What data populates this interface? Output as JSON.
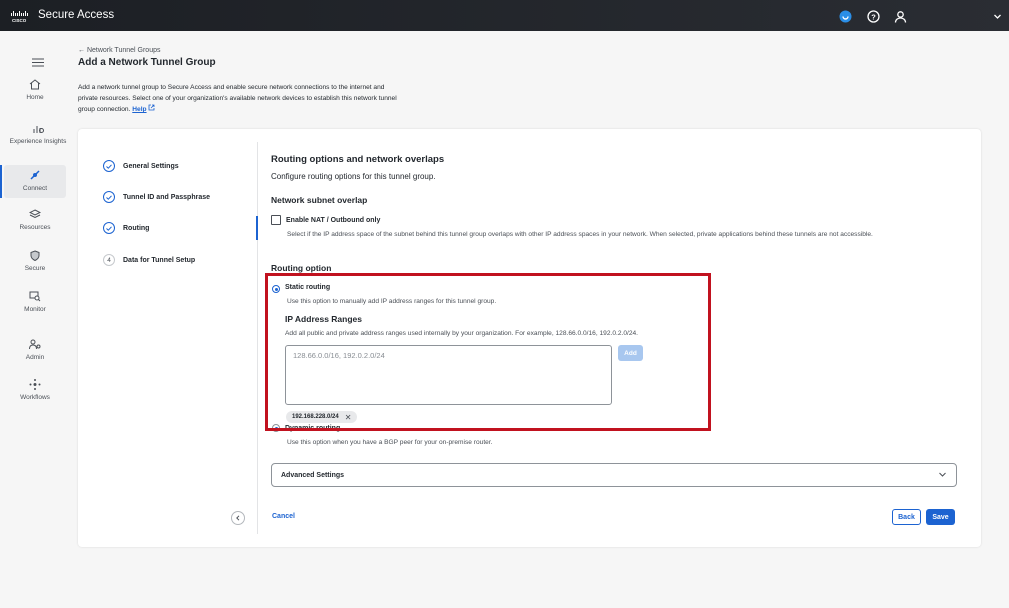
{
  "topbar": {
    "app_title": "Secure Access"
  },
  "sidebar": {
    "items": [
      {
        "label": "Home",
        "icon": "home-icon"
      },
      {
        "label": "Experience Insights",
        "icon": "insights-icon"
      },
      {
        "label": "Connect",
        "icon": "connect-icon"
      },
      {
        "label": "Resources",
        "icon": "resources-icon"
      },
      {
        "label": "Secure",
        "icon": "shield-icon"
      },
      {
        "label": "Monitor",
        "icon": "monitor-icon"
      },
      {
        "label": "Admin",
        "icon": "admin-icon"
      },
      {
        "label": "Workflows",
        "icon": "workflows-icon"
      }
    ],
    "active": "Connect"
  },
  "header": {
    "breadcrumb": "← Network Tunnel Groups",
    "title": "Add a Network Tunnel Group",
    "description": "Add a network tunnel group to Secure Access and enable secure network connections to the internet and private resources. Select one of your organization's available network devices to establish this network tunnel group connection.",
    "help_label": "Help"
  },
  "steps": [
    {
      "label": "General Settings",
      "status": "done"
    },
    {
      "label": "Tunnel ID and Passphrase",
      "status": "done"
    },
    {
      "label": "Routing",
      "status": "current"
    },
    {
      "label": "Data for Tunnel Setup",
      "status": "pending",
      "number": "4"
    }
  ],
  "routing": {
    "title": "Routing options and network overlaps",
    "subtitle": "Configure routing options for this tunnel group.",
    "overlap_heading": "Network subnet overlap",
    "nat_label": "Enable NAT / Outbound only",
    "nat_desc": "Select if the IP address space of the subnet behind this tunnel group overlaps with other IP address spaces in your network. When selected, private applications behind these tunnels are not accessible.",
    "option_heading": "Routing option",
    "static_label": "Static routing",
    "static_desc": "Use this option to manually add IP address ranges for this tunnel group.",
    "ranges_heading": "IP Address Ranges",
    "ranges_desc": "Add all public and private address ranges used internally by your organization. For example, 128.66.0.0/16, 192.0.2.0/24.",
    "textarea_placeholder": "128.66.0.0/16, 192.0.2.0/24",
    "add_label": "Add",
    "chip_value": "192.168.228.0/24",
    "dynamic_label": "Dynamic routing",
    "dynamic_desc": "Use this option when you have a BGP peer for your on-premise router.",
    "advanced_label": "Advanced Settings"
  },
  "footer": {
    "cancel_label": "Cancel",
    "back_label": "Back",
    "save_label": "Save"
  },
  "colors": {
    "accent": "#1c63d1",
    "highlight": "#c1121f"
  }
}
